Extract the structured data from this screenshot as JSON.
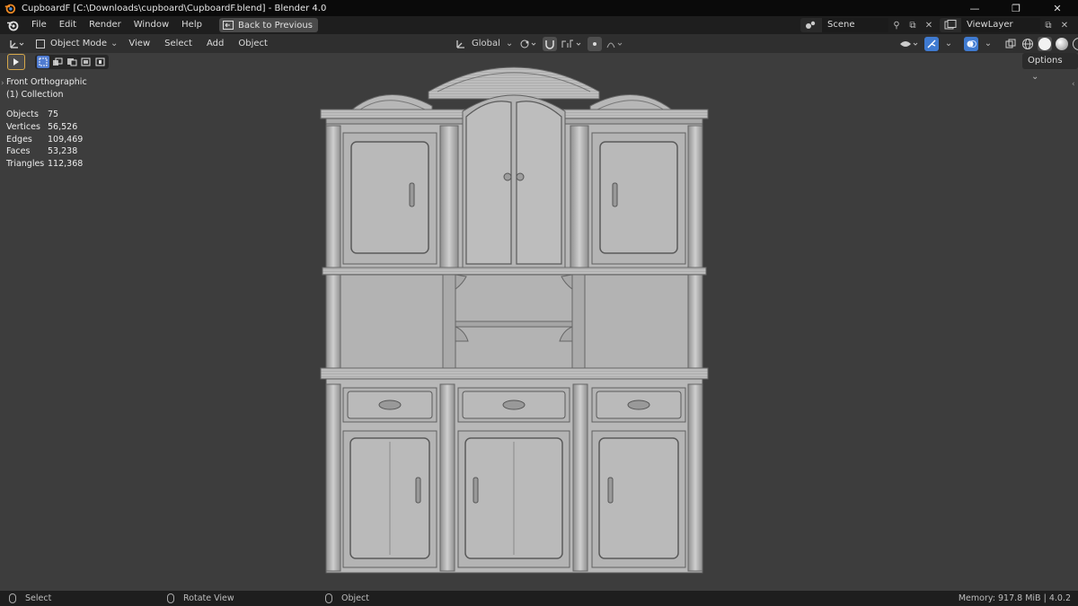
{
  "window": {
    "title": "CupboardF [C:\\Downloads\\cupboard\\CupboardF.blend] - Blender 4.0",
    "minimize": "—",
    "maximize": "❐",
    "close": "✕"
  },
  "menubar": {
    "items": [
      "File",
      "Edit",
      "Render",
      "Window",
      "Help"
    ],
    "back_button": "Back to Previous",
    "scene": "Scene",
    "view_layer": "ViewLayer"
  },
  "viewport_header": {
    "mode": "Object Mode",
    "menus": [
      "View",
      "Select",
      "Add",
      "Object"
    ],
    "transform_orientation": "Global"
  },
  "tool_settings": {
    "options_label": "Options"
  },
  "viewport_info": {
    "view_name": "Front Orthographic",
    "collection": "(1) Collection"
  },
  "stats": [
    {
      "label": "Objects",
      "value": "75"
    },
    {
      "label": "Vertices",
      "value": "56,526"
    },
    {
      "label": "Edges",
      "value": "109,469"
    },
    {
      "label": "Faces",
      "value": "53,238"
    },
    {
      "label": "Triangles",
      "value": "112,368"
    }
  ],
  "statusbar": {
    "select": "Select",
    "rotate_view": "Rotate View",
    "object": "Object",
    "memory_version": "Memory: 917.8 MiB | 4.0.2"
  },
  "colors": {
    "accent_blue": "#4f7bd0",
    "active_tool_outline": "#d6a84a",
    "viewport_bg": "#3d3d3d"
  }
}
